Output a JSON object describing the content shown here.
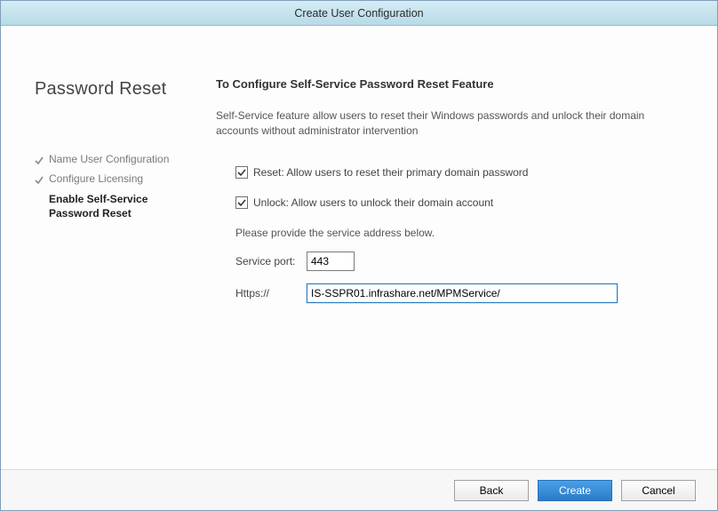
{
  "window": {
    "title": "Create User Configuration"
  },
  "left": {
    "heading": "Password Reset",
    "steps": [
      {
        "label": "Name User Configuration",
        "done": true,
        "active": false
      },
      {
        "label": "Configure Licensing",
        "done": true,
        "active": false
      },
      {
        "label": "Enable Self-Service Password Reset",
        "done": false,
        "active": true
      }
    ]
  },
  "main": {
    "title": "To Configure Self-Service Password Reset Feature",
    "description": "Self-Service feature allow users to reset their Windows passwords and unlock their domain accounts without administrator intervention",
    "checks": {
      "reset": {
        "checked": true,
        "label": "Reset: Allow users to reset their primary domain password"
      },
      "unlock": {
        "checked": true,
        "label": "Unlock: Allow users to unlock their domain account"
      }
    },
    "service_prompt": "Please provide the service address below.",
    "port_label": "Service port:",
    "port_value": "443",
    "https_label": "Https://",
    "https_value": "IS-SSPR01.infrashare.net/MPMService/"
  },
  "footer": {
    "back": "Back",
    "create": "Create",
    "cancel": "Cancel"
  }
}
